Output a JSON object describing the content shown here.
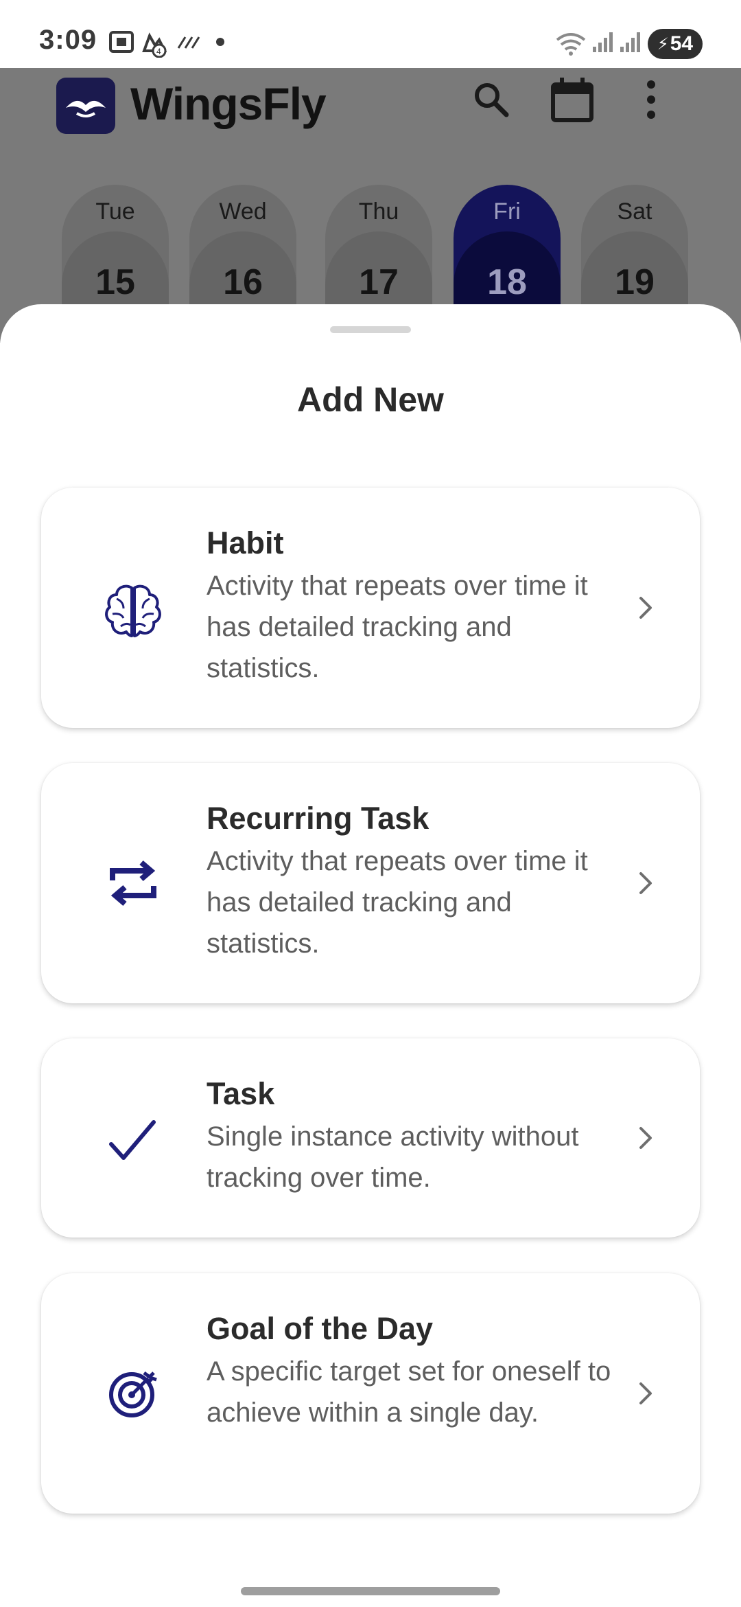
{
  "status_bar": {
    "time": "3:09",
    "icons": [
      "screenshot-icon",
      "notification-4-icon",
      "signal-strength-icon",
      "dot-icon"
    ],
    "right_icons": [
      "wifi-icon",
      "cell-signal-1-icon",
      "cell-signal-2-icon"
    ],
    "battery": "54"
  },
  "app": {
    "title": "WingsFly",
    "header_icons": [
      "search-icon",
      "calendar-icon",
      "more-vert-icon"
    ],
    "days": [
      {
        "name": "Tue",
        "date": "15"
      },
      {
        "name": "Wed",
        "date": "16"
      },
      {
        "name": "Thu",
        "date": "17"
      },
      {
        "name": "Fri",
        "date": "18",
        "selected": true
      },
      {
        "name": "Sat",
        "date": "19"
      }
    ]
  },
  "sheet": {
    "title": "Add New",
    "items": [
      {
        "title": "Habit",
        "description": "Activity that repeats over time it has detailed tracking and statistics.",
        "icon": "brain-icon"
      },
      {
        "title": "Recurring Task",
        "description": "Activity that repeats over time it has detailed tracking and statistics.",
        "icon": "repeat-icon"
      },
      {
        "title": "Task",
        "description": "Single instance activity without tracking over time.",
        "icon": "checkmark-icon"
      },
      {
        "title": "Goal of the Day",
        "description": "A specific target set for oneself to achieve within a single day.",
        "icon": "target-icon"
      }
    ]
  },
  "colors": {
    "accent": "#1f1f7a",
    "scrim": "#7a7a7a",
    "selected_day": "#14145a"
  }
}
